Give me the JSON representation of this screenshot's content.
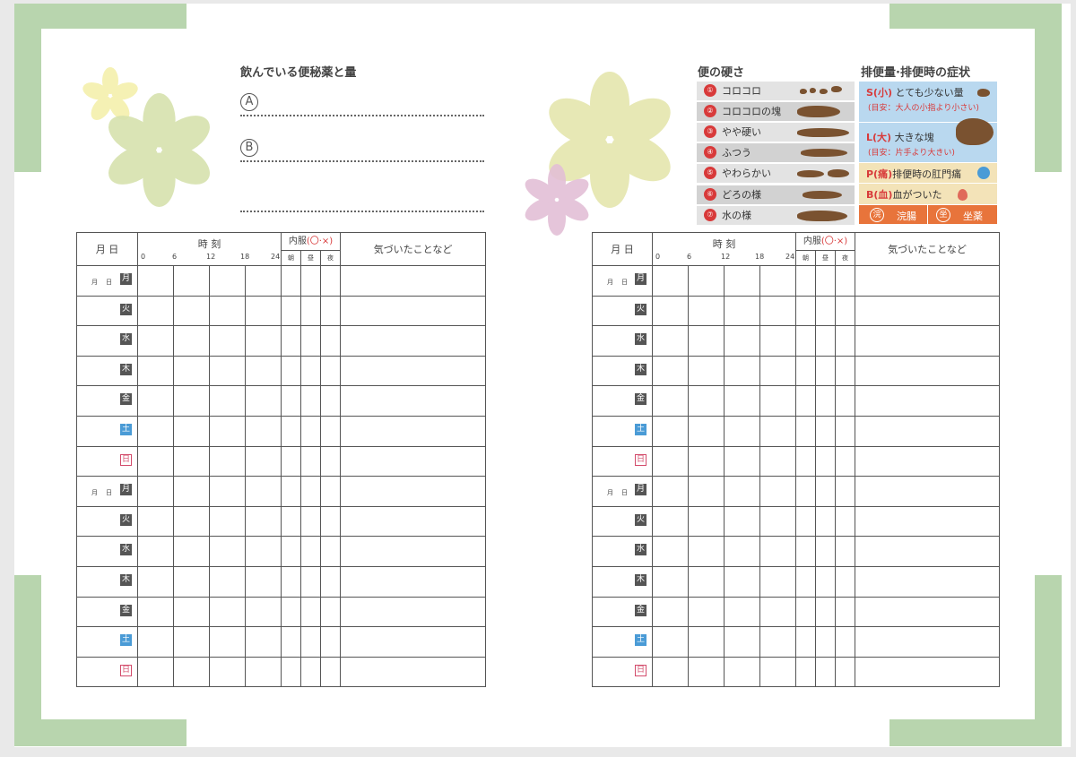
{
  "medicine": {
    "title": "飲んでいる便秘薬と量",
    "a_label": "A",
    "b_label": "B"
  },
  "table": {
    "date_header": "月 日",
    "time_header": "時 刻",
    "time_ticks": [
      "0",
      "6",
      "12",
      "18",
      "24"
    ],
    "med_header_prefix": "内服",
    "med_header_mark": "(〇·×)",
    "med_sub": [
      "朝",
      "昼",
      "夜"
    ],
    "notice_header": "気づいたことなど",
    "month_day_label": "月　日",
    "week": [
      "月",
      "火",
      "水",
      "木",
      "金",
      "土",
      "日"
    ]
  },
  "legend": {
    "hardness_title": "便の硬さ",
    "volume_title": "排便量·排便時の症状",
    "hardness": [
      {
        "num": "①",
        "label": "コロコロ"
      },
      {
        "num": "②",
        "label": "コロコロの塊"
      },
      {
        "num": "③",
        "label": "やや硬い"
      },
      {
        "num": "④",
        "label": "ふつう"
      },
      {
        "num": "⑤",
        "label": "やわらかい"
      },
      {
        "num": "⑥",
        "label": "どろの様"
      },
      {
        "num": "⑦",
        "label": "水の様"
      }
    ],
    "volume": {
      "s_code": "S(小)",
      "s_label": "とても少ない量",
      "s_note": "(目安：大人の小指より小さい)",
      "l_code": "L(大)",
      "l_label": "大きな塊",
      "l_note": "(目安：片手より大きい)",
      "p_code": "P(痛)",
      "p_label": "排便時の肛門痛",
      "b_code": "B(血)",
      "b_label": "血がついた",
      "enema_icon": "浣",
      "enema_label": "浣腸",
      "supp_icon": "坐",
      "supp_label": "坐薬"
    }
  },
  "colors": {
    "corner_green": "#b8d5ae",
    "accent_red": "#d83a3a",
    "volume_blue": "#b9d8ef",
    "volume_cream": "#f3e3b8",
    "orange": "#e8743b",
    "stool_brown": "#7a5230"
  }
}
